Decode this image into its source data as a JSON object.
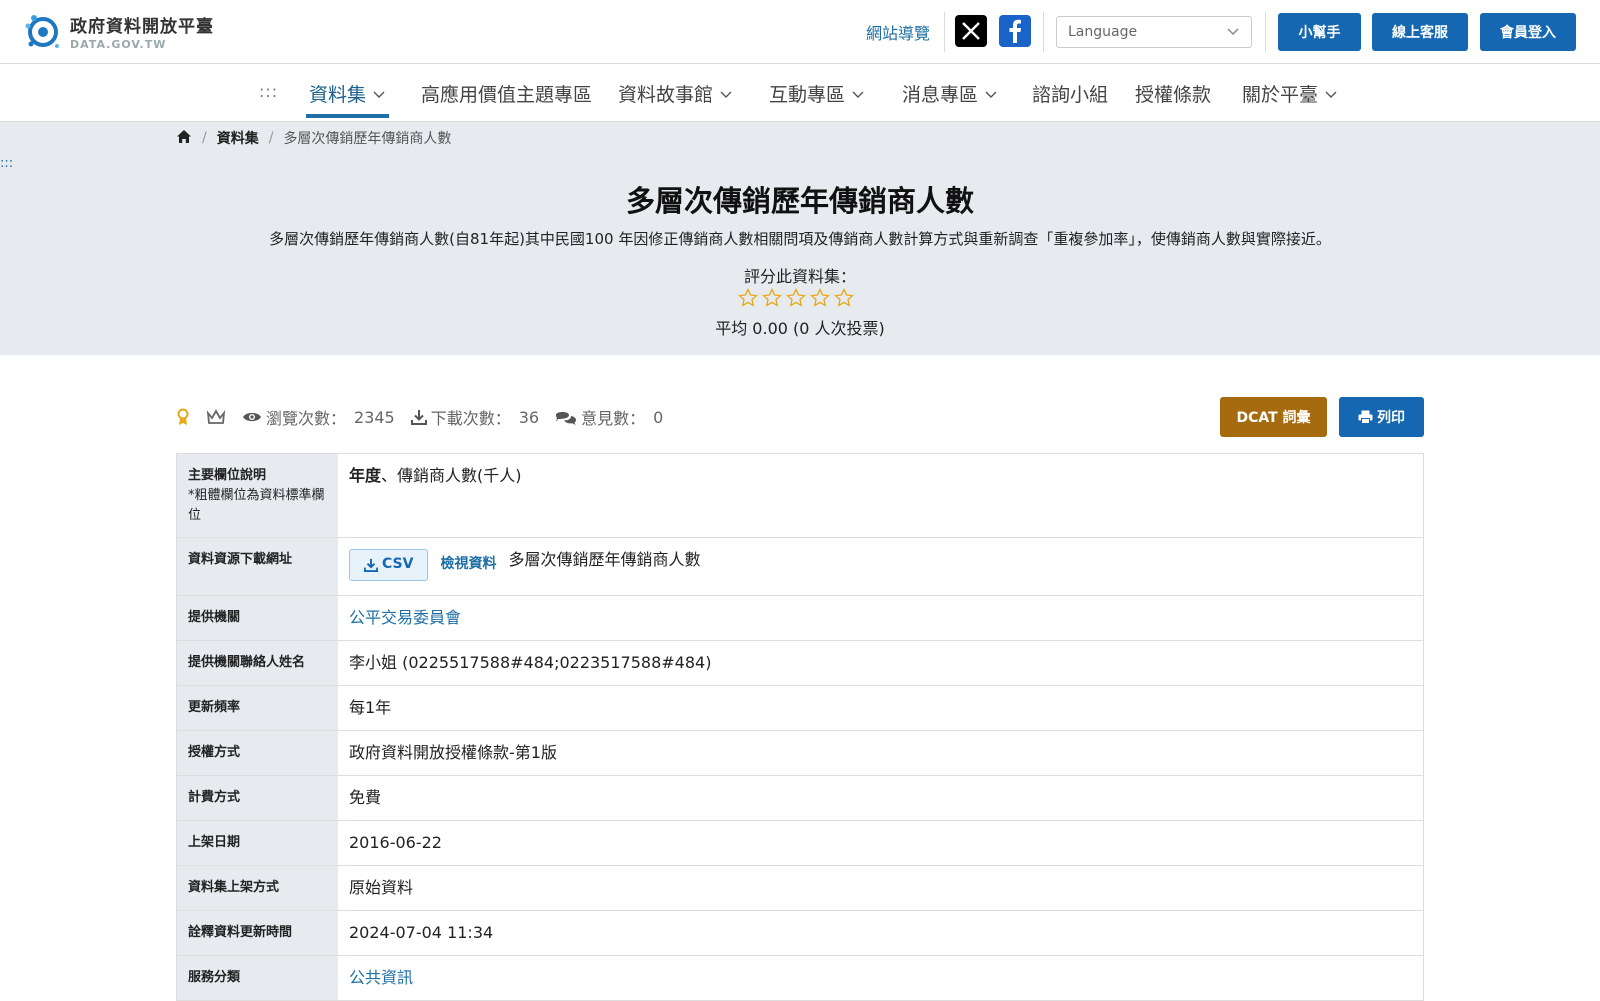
{
  "header": {
    "logo_title": "政府資料開放平臺",
    "logo_sub": "DATA.GOV.TW",
    "sitemap_label": "網站導覽",
    "language_placeholder": "Language",
    "helper_label": "小幫手",
    "support_label": "線上客服",
    "login_label": "會員登入"
  },
  "nav": {
    "accesskey": ":::",
    "items": [
      {
        "label": "資料集"
      },
      {
        "label": "高應用價值主題專區"
      },
      {
        "label": "資料故事館"
      },
      {
        "label": "互動專區"
      },
      {
        "label": "消息專區"
      },
      {
        "label": "諮詢小組"
      },
      {
        "label": "授權條款"
      },
      {
        "label": "關於平臺"
      }
    ]
  },
  "breadcrumb": {
    "level1": "資料集",
    "current": "多層次傳銷歷年傳銷商人數"
  },
  "hero": {
    "accesskey": ":::",
    "title": "多層次傳銷歷年傳銷商人數",
    "description": "多層次傳銷歷年傳銷商人數(自81年起)其中民國100 年因修正傳銷商人數相關問項及傳銷商人數計算方式與重新調查「重複參加率」，使傳銷商人數與實際接近。",
    "rating_label": "評分此資料集：",
    "rating_value": 0,
    "rating_avg": "平均 0.00 (0 人次投票)"
  },
  "stats": {
    "views_label": "瀏覽次數：",
    "views": "2345",
    "downloads_label": "下載次數：",
    "downloads": "36",
    "comments_label": "意見數：",
    "comments": "0"
  },
  "actions": {
    "dcat_label": "DCAT 詞彙",
    "print_label": "列印"
  },
  "info": {
    "fields_label": "主要欄位說明",
    "fields_note": "*粗體欄位為資料標準欄位",
    "fields_bold": "年度",
    "fields_rest": "、傳銷商人數(千人)",
    "resource_label": "資料資源下載網址",
    "csv_label": "CSV",
    "view_label": "檢視資料",
    "resource_name": "多層次傳銷歷年傳銷商人數",
    "agency_label": "提供機關",
    "agency": "公平交易委員會",
    "contact_label": "提供機關聯絡人姓名",
    "contact": "李小姐 (0225517588#484;0223517588#484)",
    "frequency_label": "更新頻率",
    "frequency": "每1年",
    "license_label": "授權方式",
    "license": "政府資料開放授權條款-第1版",
    "fee_label": "計費方式",
    "fee": "免費",
    "published_label": "上架日期",
    "published": "2016-06-22",
    "method_label": "資料集上架方式",
    "method": "原始資料",
    "meta_updated_label": "詮釋資料更新時間",
    "meta_updated": "2024-07-04 11:34",
    "category_label": "服務分類",
    "category": "公共資訊"
  },
  "colors": {
    "primary": "#1467b0",
    "link": "#1d6fa5",
    "dcat": "#a76b0f",
    "hero_bg": "#e7ebf0",
    "star": "#e6a817"
  }
}
